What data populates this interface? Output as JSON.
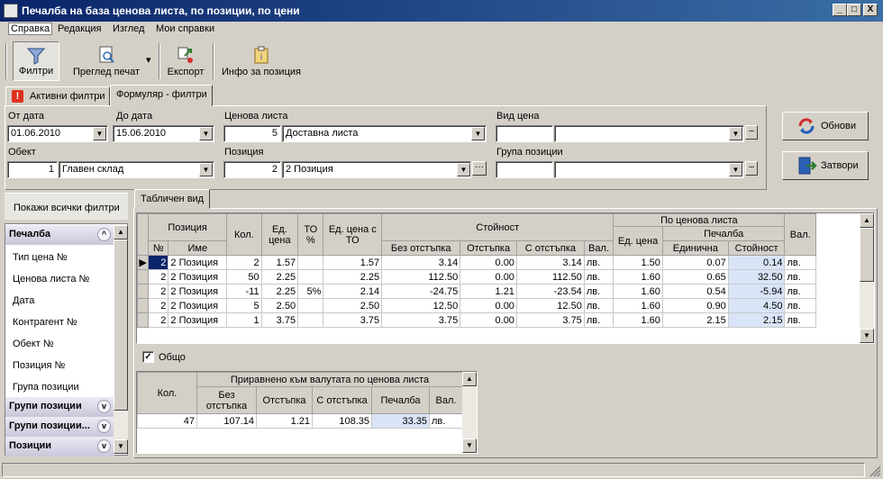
{
  "window": {
    "title": "Печалба на база ценова листа, по позиции, по цени",
    "min": "_",
    "max": "□",
    "close": "X"
  },
  "menu": [
    "Справка",
    "Редакция",
    "Изглед",
    "Мои справки"
  ],
  "toolbar": {
    "filters": "Филтри",
    "print_preview": "Преглед печат",
    "dropdown_arrow": "▾",
    "export": "Експорт",
    "position_info": "Инфо за позиция"
  },
  "filter_tabs": {
    "active": "Активни филтри",
    "form": "Формуляр - филтри",
    "warning_icon_text": "!"
  },
  "form": {
    "date_from_label": "От дата",
    "date_from": "01.06.2010",
    "date_to_label": "До дата",
    "date_to": "15.06.2010",
    "price_list_label": "Ценова листа",
    "price_list_code": "5",
    "price_list_name": "Доставна листа",
    "price_type_label": "Вид цена",
    "object_label": "Обект",
    "object_code": "1",
    "object_name": "Главен склад",
    "position_label": "Позиция",
    "position_code": "2",
    "position_name": "2 Позиция",
    "ellipsis": "···",
    "position_group_label": "Група позиции",
    "clear_glyph": "‒",
    "arrow_glyph": "▼"
  },
  "actions": {
    "refresh": "Обнови",
    "close": "Затвори"
  },
  "nav": {
    "show_all": "Покажи всички филтри",
    "groups": [
      {
        "label": "Печалба",
        "chevron": "^"
      },
      {
        "label": "Групи позиции",
        "chevron": "v"
      },
      {
        "label": "Групи позиции...",
        "chevron": "v"
      },
      {
        "label": "Позиции",
        "chevron": "v"
      }
    ],
    "items": [
      "Тип цена №",
      "Ценова листа №",
      "Дата",
      "Контрагент №",
      "Обект №",
      "Позиция №",
      "Група позиции"
    ]
  },
  "view_tab": "Табличен вид",
  "grid": {
    "headers": {
      "position": "Позиция",
      "no": "№",
      "name": "Име",
      "qty": "Кол.",
      "unit_price": "Ед. цена",
      "to_pct": "ТО %",
      "unit_price_to": "Ед. цена с ТО",
      "value": "Стойност",
      "no_discount": "Без отстъпка",
      "discount": "Отстъпка",
      "with_discount": "С отстъпка",
      "currency": "Вал.",
      "by_price_list": "По ценова листа",
      "pl_unit_price": "Ед. цена",
      "profit": "Печалба",
      "profit_unit": "Единична",
      "profit_value": "Стойност",
      "pl_currency": "Вал."
    },
    "rows": [
      [
        "2",
        "2 Позиция",
        "2",
        "1.57",
        "",
        "1.57",
        "3.14",
        "0.00",
        "3.14",
        "лв.",
        "1.50",
        "0.07",
        "0.14",
        "лв."
      ],
      [
        "2",
        "2 Позиция",
        "50",
        "2.25",
        "",
        "2.25",
        "112.50",
        "0.00",
        "112.50",
        "лв.",
        "1.60",
        "0.65",
        "32.50",
        "лв."
      ],
      [
        "2",
        "2 Позиция",
        "-11",
        "2.25",
        "5%",
        "2.14",
        "-24.75",
        "1.21",
        "-23.54",
        "лв.",
        "1.60",
        "0.54",
        "-5.94",
        "лв."
      ],
      [
        "2",
        "2 Позиция",
        "5",
        "2.50",
        "",
        "2.50",
        "12.50",
        "0.00",
        "12.50",
        "лв.",
        "1.60",
        "0.90",
        "4.50",
        "лв."
      ],
      [
        "2",
        "2 Позиция",
        "1",
        "3.75",
        "",
        "3.75",
        "3.75",
        "0.00",
        "3.75",
        "лв.",
        "1.60",
        "2.15",
        "2.15",
        "лв."
      ]
    ],
    "current_row_marker": "▶"
  },
  "totals": {
    "checkbox_label": "Общо",
    "checked_glyph": "✓",
    "headers": {
      "qty": "Кол.",
      "group": "Приравнено към валутата по ценова листа",
      "no_discount": "Без отстъпка",
      "discount": "Отстъпка",
      "with_discount": "С отстъпка",
      "profit": "Печалба",
      "currency": "Вал."
    },
    "row": [
      "47",
      "107.14",
      "1.21",
      "108.35",
      "33.35",
      "лв."
    ]
  },
  "scroll": {
    "up": "▲",
    "down": "▼"
  }
}
